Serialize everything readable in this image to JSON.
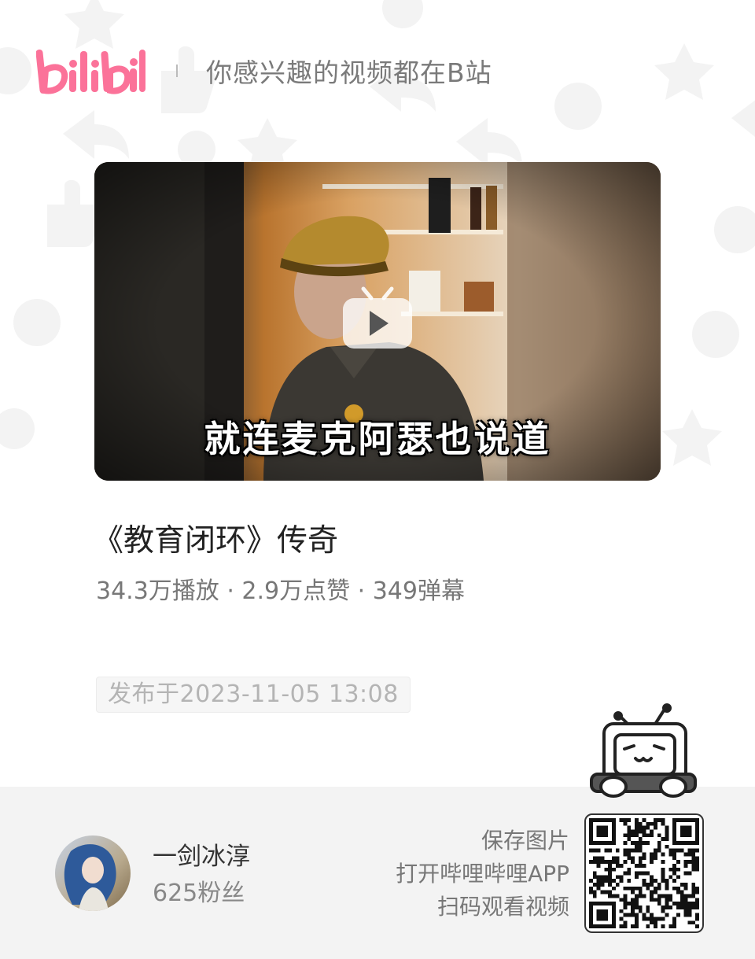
{
  "header": {
    "logo_text": "bilibili",
    "slogan": "你感兴趣的视频都在B站"
  },
  "video": {
    "caption": "就连麦克阿瑟也说道",
    "title": "《教育闭环》传奇",
    "stats": "34.3万播放 · 2.9万点赞 · 349弹幕",
    "publish_time": "发布于2023-11-05 13:08"
  },
  "author": {
    "name": "一剑冰淳",
    "fans": "625粉丝"
  },
  "cta": {
    "line1": "保存图片",
    "line2": "打开哔哩哔哩APP",
    "line3": "扫码观看视频"
  },
  "colors": {
    "brand_pink": "#fb7299",
    "footer_bg": "#f3f3f3"
  },
  "icons": [
    "bilibili-logo",
    "play-icon",
    "tv-mascot-icon",
    "qr-code"
  ]
}
